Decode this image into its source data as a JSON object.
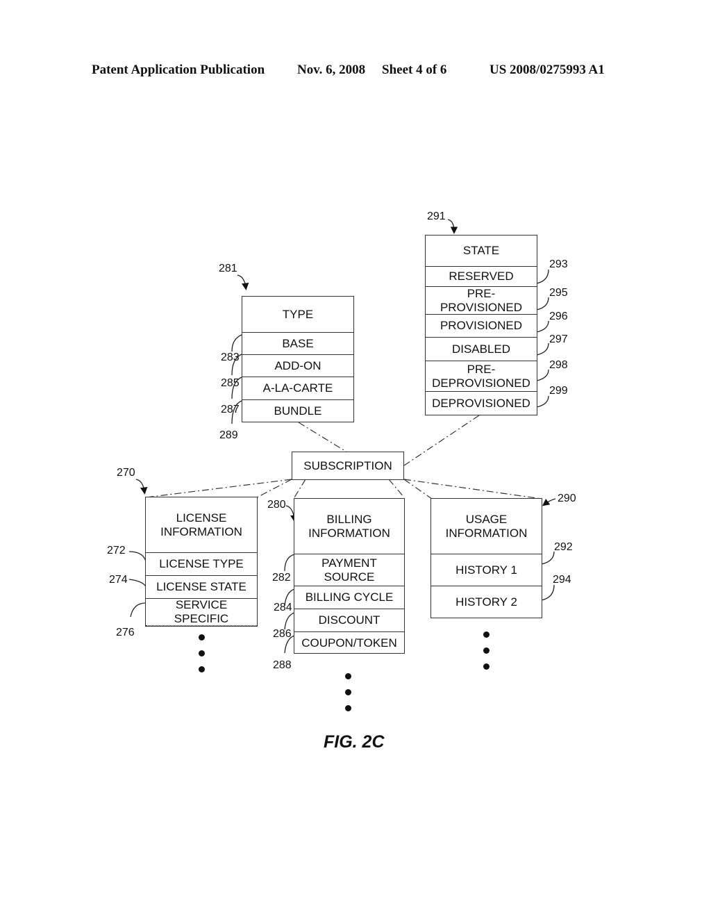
{
  "header": {
    "left": "Patent Application Publication",
    "date": "Nov. 6, 2008",
    "sheet": "Sheet 4 of 6",
    "number": "US 2008/0275993 A1"
  },
  "figure_label": "FIG. 2C",
  "root": {
    "label": "SUBSCRIPTION"
  },
  "type_box": {
    "ref": "281",
    "title": "TYPE",
    "rows": [
      {
        "label": "BASE",
        "ref": "283"
      },
      {
        "label": "ADD-ON",
        "ref": "285"
      },
      {
        "label": "A-LA-CARTE",
        "ref": "287"
      },
      {
        "label": "BUNDLE",
        "ref": "289"
      }
    ]
  },
  "state_box": {
    "ref": "291",
    "title": "STATE",
    "rows": [
      {
        "label": "RESERVED",
        "ref": "293"
      },
      {
        "label": "PRE-\nPROVISIONED",
        "ref": "295"
      },
      {
        "label": "PROVISIONED",
        "ref": "296"
      },
      {
        "label": "DISABLED",
        "ref": "297"
      },
      {
        "label": "PRE-\nDEPROVISIONED",
        "ref": "298"
      },
      {
        "label": "DEPROVISIONED",
        "ref": "299"
      }
    ]
  },
  "license_box": {
    "ref": "270",
    "title": "LICENSE\nINFORMATION",
    "rows": [
      {
        "label": "LICENSE TYPE",
        "ref": "272"
      },
      {
        "label": "LICENSE STATE",
        "ref": "274"
      },
      {
        "label": "SERVICE\nSPECIFIC",
        "ref": "276"
      }
    ]
  },
  "billing_box": {
    "ref": "280",
    "title": "BILLING\nINFORMATION",
    "rows": [
      {
        "label": "PAYMENT\nSOURCE",
        "ref": "282"
      },
      {
        "label": "BILLING CYCLE",
        "ref": "284"
      },
      {
        "label": "DISCOUNT",
        "ref": "286"
      },
      {
        "label": "COUPON/TOKEN",
        "ref": "288"
      }
    ]
  },
  "usage_box": {
    "ref": "290",
    "title": "USAGE\nINFORMATION",
    "rows": [
      {
        "label": "HISTORY 1",
        "ref": "292"
      },
      {
        "label": "HISTORY 2",
        "ref": "294"
      }
    ]
  }
}
